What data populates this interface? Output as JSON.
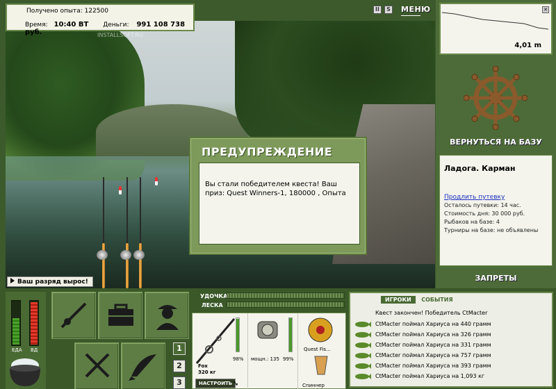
{
  "top_info": {
    "experience_label": "Получено опыта:",
    "experience_value": "122500",
    "time_label": "Время:",
    "time_value": "10:40 ВТ",
    "money_label": "Деньги:",
    "money_value": "991 108 738 руб."
  },
  "watermark": "INSTALLSOFT.RU",
  "toolbar": {
    "pause_label": "II",
    "sound_label": "S",
    "menu_label": "МЕНЮ"
  },
  "depth": {
    "value": "4,01 m"
  },
  "right_panel": {
    "base_button": "ВЕРНУТЬСЯ НА БАЗУ",
    "location_title": "Ладога. Карман",
    "extend_link": "Продлить путевку",
    "lines": [
      "Осталось путевки: 14 час.",
      "Стоимость дня: 30 000 руб.",
      "Рыбаков на базе: 4",
      "Турниры на базе: не объявлены"
    ],
    "bans_button": "ЗАПРЕТЫ"
  },
  "dialog": {
    "title": "ПРЕДУПРЕЖДЕНИЕ",
    "message": "Вы стали победителем квеста! Ваш приз: Quest Winners-1, 180000 , Опыта"
  },
  "rank_badge": "Ваш разряд вырос!",
  "needs": {
    "food_label": "ЕДА",
    "drink_label": "ВД",
    "food_level": 0.6,
    "drink_level": 0.95
  },
  "slots": [
    "1",
    "2",
    "3"
  ],
  "tackle": {
    "rod_label": "УДОЧКА",
    "line_label": "ЛЕСКА",
    "rod_name": "Fox",
    "rod_weight": "320 кг",
    "rod_pct": "98%",
    "reel_power": "мощн.: 135",
    "reel_pct": "99%",
    "line_name": "Quest Fis...",
    "lure_name": "Спиннер",
    "adjust_button": "НАСТРОИТЬ"
  },
  "events": {
    "tab_players": "ИГРОКИ",
    "tab_events": "СОБЫТИЯ",
    "header": "Квест закончен! Победитель CtMacter",
    "rows": [
      "CtMacter поймал Хариуса на 440 грамм",
      "CtMacter поймал Хариуса на 326 грамм",
      "CtMacter поймал Хариуса на 331 грамм",
      "CtMacter поймал Хариуса на 757 грамм",
      "CtMacter поймал Хариуса на 393 грамм",
      "CtMacter поймал Хариуса на 1,093 кг"
    ]
  },
  "colors": {
    "panel_green": "#4d6b38",
    "dark_green": "#3a5828",
    "paper": "#f4f4ec",
    "link_blue": "#1a2fbf"
  }
}
